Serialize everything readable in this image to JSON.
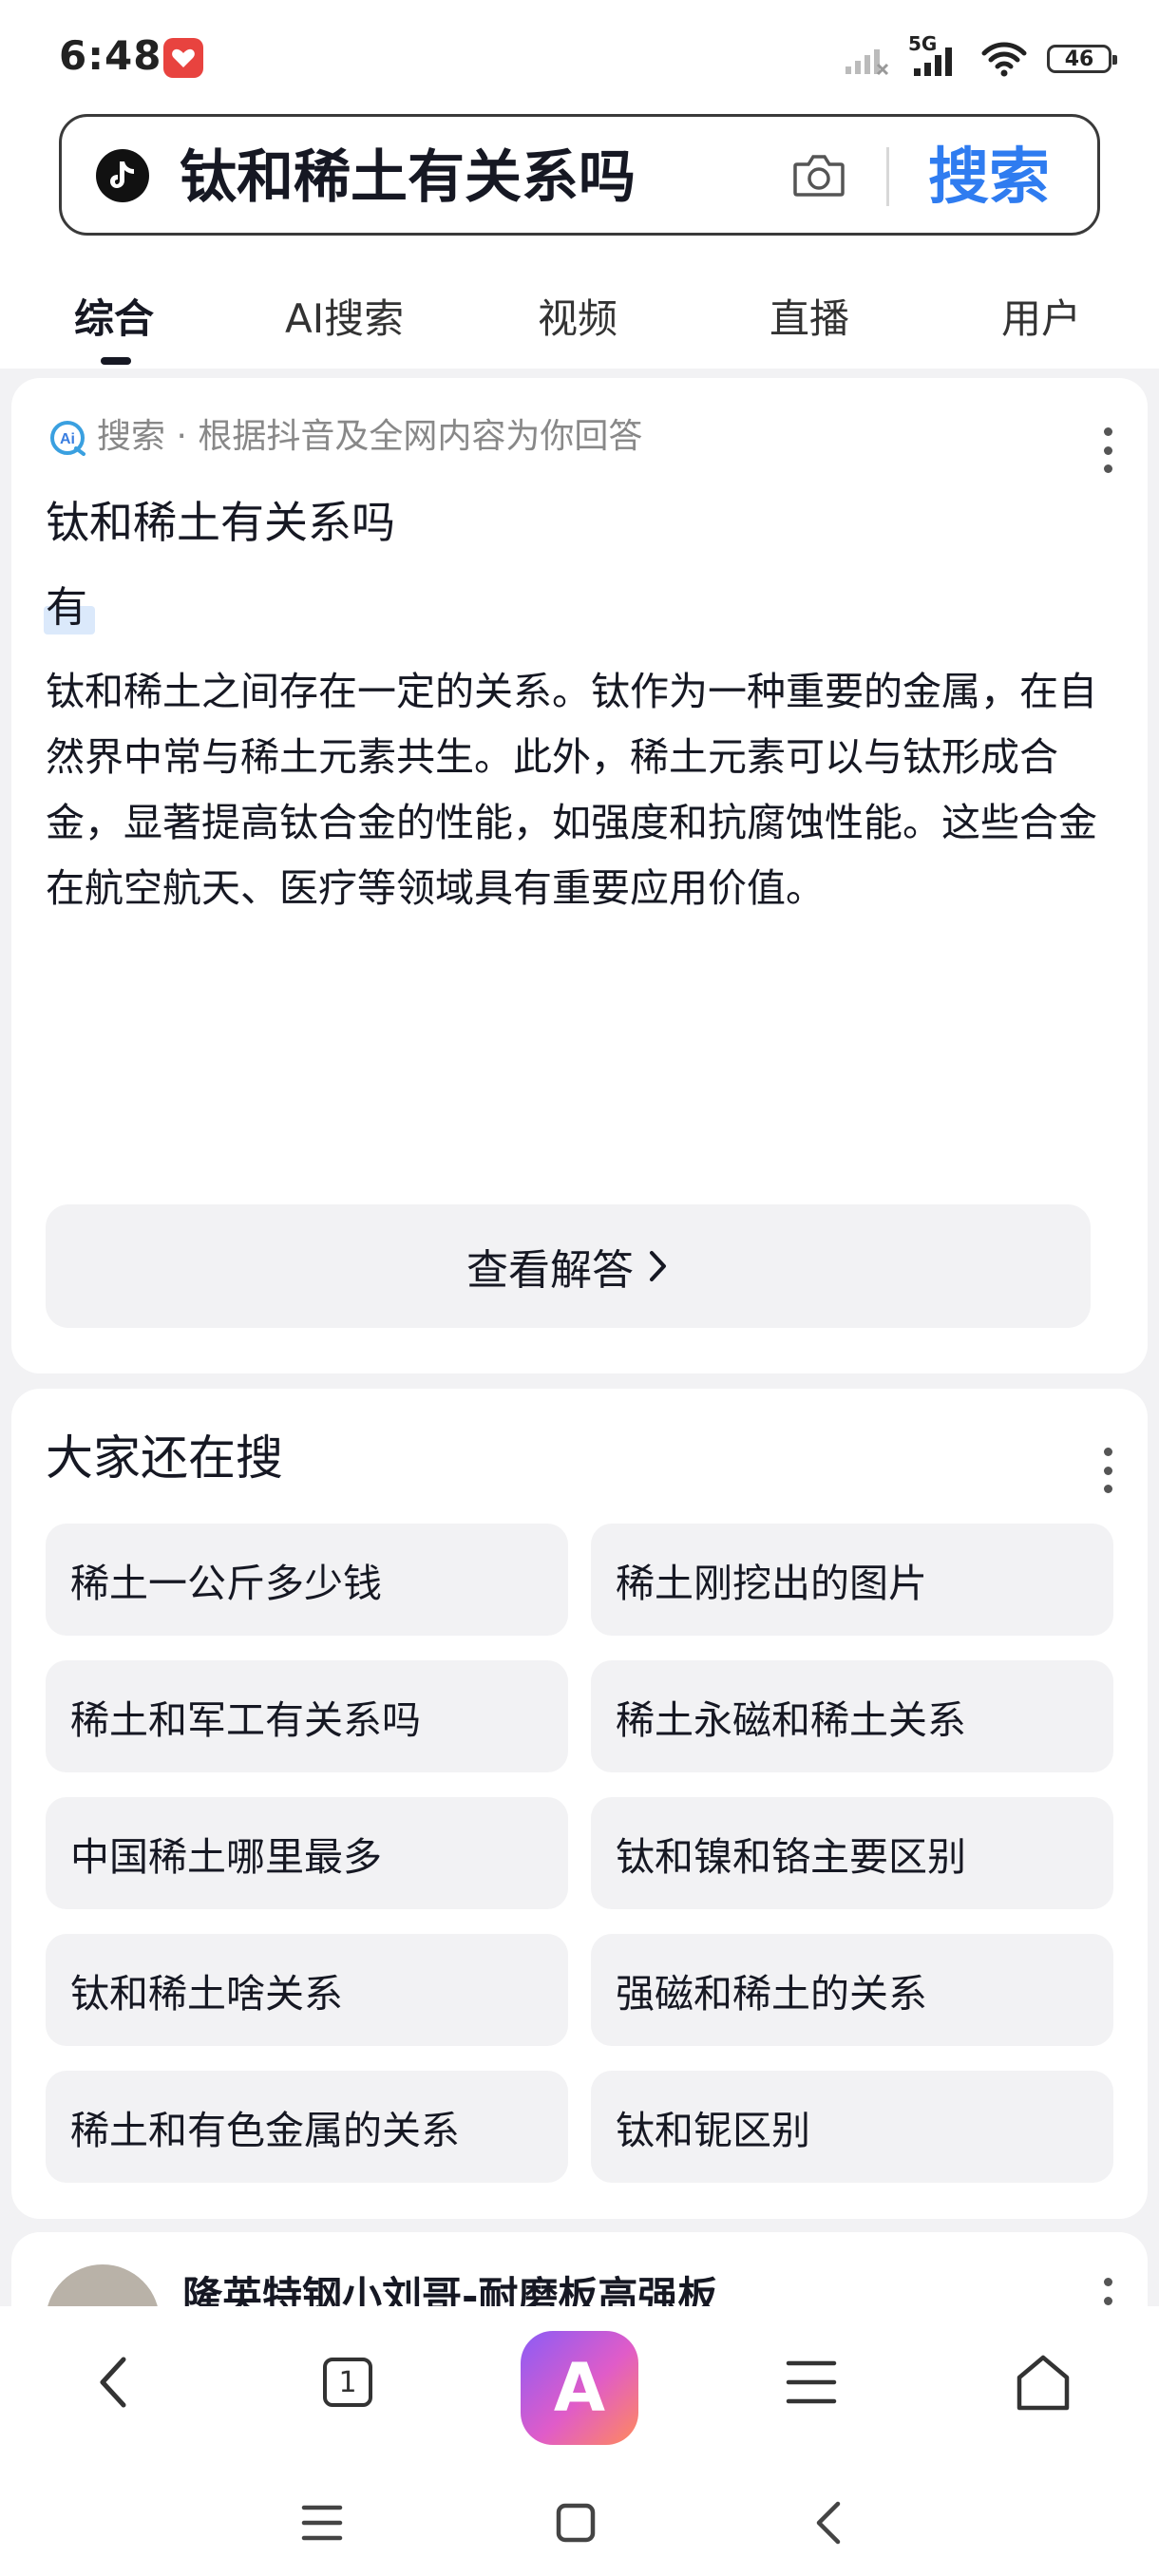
{
  "status_bar": {
    "time": "6:48",
    "network": "5G",
    "battery": "46"
  },
  "search": {
    "query": "钛和稀土有关系吗",
    "button_label": "搜索",
    "app_icon": "tiktok-icon"
  },
  "tabs": [
    {
      "label": "综合",
      "active": true
    },
    {
      "label": "AI搜索",
      "active": false
    },
    {
      "label": "视频",
      "active": false
    },
    {
      "label": "直播",
      "active": false
    },
    {
      "label": "用户",
      "active": false
    }
  ],
  "ai_card": {
    "badge": "Ai",
    "subtitle": "搜索 · 根据抖音及全网内容为你回答",
    "title": "钛和稀土有关系吗",
    "short_answer": "有",
    "answer": "钛和稀土之间存在一定的关系。钛作为一种重要的金属，在自然界中常与稀土元素共生。此外，稀土元素可以与钛形成合金，显著提高钛合金的性能，如强度和抗腐蚀性能。这些合金在航空航天、医疗等领域具有重要应用价值。",
    "view_button": "查看解答"
  },
  "related": {
    "title": "大家还在搜",
    "items": [
      "稀土一公斤多少钱",
      "稀土刚挖出的图片",
      "稀土和军工有关系吗",
      "稀土永磁和稀土关系",
      "中国稀土哪里最多",
      "钛和镍和铬主要区别",
      "钛和稀土啥关系",
      "强磁和稀土的关系",
      "稀土和有色金属的关系",
      "钛和铌区别"
    ]
  },
  "result_card": {
    "title": "隆英特钢小刘哥-耐磨板高强板"
  },
  "bottom_nav": {
    "tab_count": "1",
    "center_app_letter": "A"
  },
  "colors": {
    "accent": "#2f7cf0",
    "background": "#f2f2f4",
    "text": "#161823"
  }
}
